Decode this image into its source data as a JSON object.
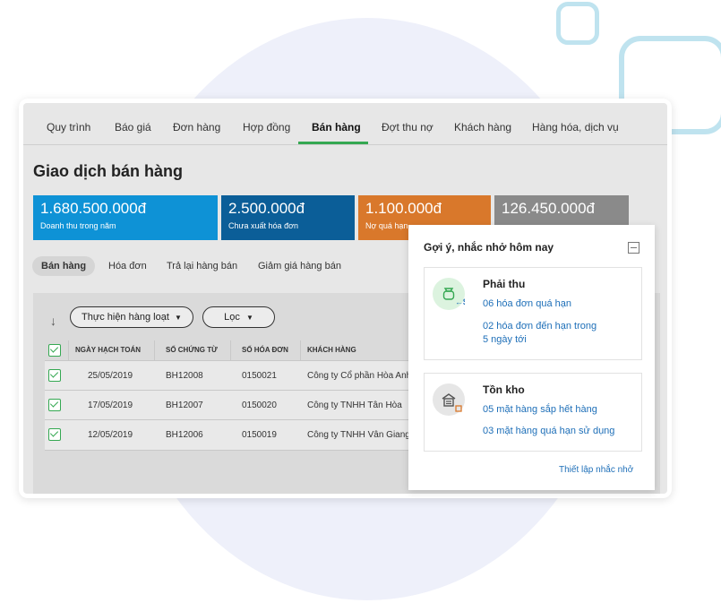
{
  "nav": {
    "tabs": [
      "Quy trình",
      "Báo giá",
      "Đơn hàng",
      "Hợp đồng",
      "Bán hàng",
      "Đợt thu nợ",
      "Khách hàng",
      "Hàng hóa, dịch vụ"
    ],
    "active": "Bán hàng"
  },
  "page": {
    "title": "Giao dịch bán hàng"
  },
  "stats": [
    {
      "value": "1.680.500.000đ",
      "label": "Doanh thu trong năm",
      "color": "#0e92d6"
    },
    {
      "value": "2.500.000đ",
      "label": "Chưa xuất hóa đơn",
      "color": "#0b5e98"
    },
    {
      "value": "1.100.000đ",
      "label": "Nợ quá hạn",
      "color": "#d9782b"
    },
    {
      "value": "126.450.000đ",
      "label": "",
      "color": "#8a8a8a"
    }
  ],
  "subtabs": [
    "Bán hàng",
    "Hóa đơn",
    "Trả lại hàng bán",
    "Giảm giá hàng bán"
  ],
  "toolbar": {
    "bulk_label": "Thực hiện hàng loạt",
    "filter_label": "Lọc"
  },
  "table": {
    "columns": [
      "NGÀY HẠCH TOÁN",
      "SỐ CHỨNG TỪ",
      "SỐ HÓA ĐƠN",
      "KHÁCH HÀNG"
    ],
    "rows": [
      {
        "date": "25/05/2019",
        "voucher": "BH12008",
        "invoice": "0150021",
        "customer": "Công ty Cổ phần Hòa Anh"
      },
      {
        "date": "17/05/2019",
        "voucher": "BH12007",
        "invoice": "0150020",
        "customer": "Công ty TNHH Tân Hòa"
      },
      {
        "date": "12/05/2019",
        "voucher": "BH12006",
        "invoice": "0150019",
        "customer": "Công ty TNHH Vân Giang"
      }
    ]
  },
  "reminders": {
    "title": "Gợi ý, nhắc nhở hôm nay",
    "receivable": {
      "title": "Phải thu",
      "link1": "06 hóa đơn quá hạn",
      "link2_line1": "02 hóa đơn đến hạn trong",
      "link2_line2": "5 ngày tới"
    },
    "inventory": {
      "title": "Tồn kho",
      "link1": "05 mặt hàng sắp hết hàng",
      "link2": "03 mặt hàng quá hạn sử dụng"
    },
    "settings_link": "Thiết lập nhắc nhở"
  },
  "colors": {
    "accent_green": "#35a852",
    "link_blue": "#1e6fb8"
  }
}
